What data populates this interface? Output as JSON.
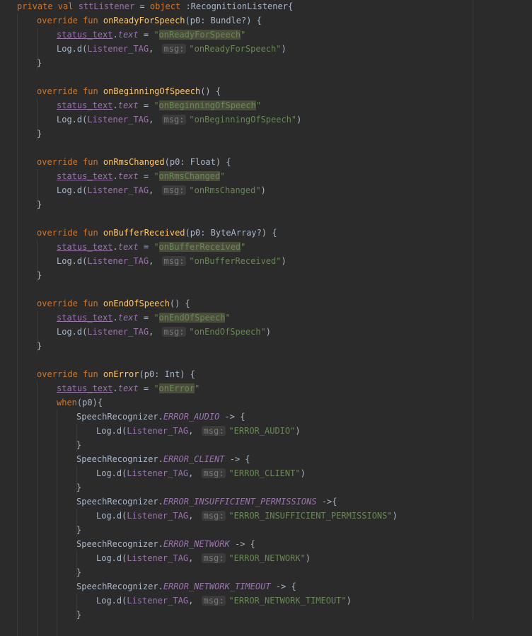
{
  "lines": [
    {
      "indent": 0,
      "toks": [
        [
          "kw",
          "private val "
        ],
        [
          "p",
          "sttListener"
        ],
        [
          "t",
          " = "
        ],
        [
          "kw",
          "object "
        ],
        [
          "t",
          ":RecognitionListener{"
        ]
      ]
    },
    {
      "indent": 1,
      "toks": [
        [
          "kw",
          "override fun "
        ],
        [
          "fn",
          "onReadyForSpeech"
        ],
        [
          "t",
          "(p0: Bundle?) {"
        ]
      ]
    },
    {
      "indent": 2,
      "toks": [
        [
          "pu",
          "status_text"
        ],
        [
          "t",
          "."
        ],
        [
          "pi",
          "text"
        ],
        [
          "t",
          " = "
        ],
        [
          "s",
          "\""
        ],
        [
          "sh",
          "onReadyForSpeech"
        ],
        [
          "s",
          "\""
        ]
      ]
    },
    {
      "indent": 2,
      "toks": [
        [
          "t",
          "Log.d("
        ],
        [
          "p",
          "Listener_TAG"
        ],
        [
          "t",
          ", "
        ],
        [
          "h",
          "msg:"
        ],
        [
          "s",
          "\"onReadyForSpeech\""
        ],
        [
          "t",
          ")"
        ]
      ]
    },
    {
      "indent": 1,
      "toks": [
        [
          "t",
          "}"
        ]
      ]
    },
    {
      "indent": 0,
      "toks": []
    },
    {
      "indent": 1,
      "toks": [
        [
          "kw",
          "override fun "
        ],
        [
          "fn",
          "onBeginningOfSpeech"
        ],
        [
          "t",
          "() {"
        ]
      ]
    },
    {
      "indent": 2,
      "toks": [
        [
          "pu",
          "status_text"
        ],
        [
          "t",
          "."
        ],
        [
          "pi",
          "text"
        ],
        [
          "t",
          " = "
        ],
        [
          "s",
          "\""
        ],
        [
          "sh",
          "onBeginningOfSpeech"
        ],
        [
          "s",
          "\""
        ]
      ]
    },
    {
      "indent": 2,
      "toks": [
        [
          "t",
          "Log.d("
        ],
        [
          "p",
          "Listener_TAG"
        ],
        [
          "t",
          ", "
        ],
        [
          "h",
          "msg:"
        ],
        [
          "s",
          "\"onBeginningOfSpeech\""
        ],
        [
          "t",
          ")"
        ]
      ]
    },
    {
      "indent": 1,
      "toks": [
        [
          "t",
          "}"
        ]
      ]
    },
    {
      "indent": 0,
      "toks": []
    },
    {
      "indent": 1,
      "toks": [
        [
          "kw",
          "override fun "
        ],
        [
          "fn",
          "onRmsChanged"
        ],
        [
          "t",
          "(p0: Float) {"
        ]
      ]
    },
    {
      "indent": 2,
      "toks": [
        [
          "pu",
          "status_text"
        ],
        [
          "t",
          "."
        ],
        [
          "pi",
          "text"
        ],
        [
          "t",
          " = "
        ],
        [
          "s",
          "\""
        ],
        [
          "sh",
          "onRmsChanged"
        ],
        [
          "s",
          "\""
        ]
      ]
    },
    {
      "indent": 2,
      "toks": [
        [
          "t",
          "Log.d("
        ],
        [
          "p",
          "Listener_TAG"
        ],
        [
          "t",
          ", "
        ],
        [
          "h",
          "msg:"
        ],
        [
          "s",
          "\"onRmsChanged\""
        ],
        [
          "t",
          ")"
        ]
      ]
    },
    {
      "indent": 1,
      "toks": [
        [
          "t",
          "}"
        ]
      ]
    },
    {
      "indent": 0,
      "toks": []
    },
    {
      "indent": 1,
      "toks": [
        [
          "kw",
          "override fun "
        ],
        [
          "fn",
          "onBufferReceived"
        ],
        [
          "t",
          "(p0: ByteArray?) {"
        ]
      ]
    },
    {
      "indent": 2,
      "toks": [
        [
          "pu",
          "status_text"
        ],
        [
          "t",
          "."
        ],
        [
          "pi",
          "text"
        ],
        [
          "t",
          " = "
        ],
        [
          "s",
          "\""
        ],
        [
          "sh",
          "onBufferReceived"
        ],
        [
          "s",
          "\""
        ]
      ]
    },
    {
      "indent": 2,
      "toks": [
        [
          "t",
          "Log.d("
        ],
        [
          "p",
          "Listener_TAG"
        ],
        [
          "t",
          ", "
        ],
        [
          "h",
          "msg:"
        ],
        [
          "s",
          "\"onBufferReceived\""
        ],
        [
          "t",
          ")"
        ]
      ]
    },
    {
      "indent": 1,
      "toks": [
        [
          "t",
          "}"
        ]
      ]
    },
    {
      "indent": 0,
      "toks": []
    },
    {
      "indent": 1,
      "toks": [
        [
          "kw",
          "override fun "
        ],
        [
          "fn",
          "onEndOfSpeech"
        ],
        [
          "t",
          "() {"
        ]
      ]
    },
    {
      "indent": 2,
      "toks": [
        [
          "pu",
          "status_text"
        ],
        [
          "t",
          "."
        ],
        [
          "pi",
          "text"
        ],
        [
          "t",
          " = "
        ],
        [
          "s",
          "\""
        ],
        [
          "sh",
          "onEndOfSpeech"
        ],
        [
          "s",
          "\""
        ]
      ]
    },
    {
      "indent": 2,
      "toks": [
        [
          "t",
          "Log.d("
        ],
        [
          "p",
          "Listener_TAG"
        ],
        [
          "t",
          ", "
        ],
        [
          "h",
          "msg:"
        ],
        [
          "s",
          "\"onEndOfSpeech\""
        ],
        [
          "t",
          ")"
        ]
      ]
    },
    {
      "indent": 1,
      "toks": [
        [
          "t",
          "}"
        ]
      ]
    },
    {
      "indent": 0,
      "toks": []
    },
    {
      "indent": 1,
      "toks": [
        [
          "kw",
          "override fun "
        ],
        [
          "fn",
          "onError"
        ],
        [
          "t",
          "(p0: Int) {"
        ]
      ]
    },
    {
      "indent": 2,
      "toks": [
        [
          "pu",
          "status_text"
        ],
        [
          "t",
          "."
        ],
        [
          "pi",
          "text"
        ],
        [
          "t",
          " = "
        ],
        [
          "s",
          "\""
        ],
        [
          "sh",
          "onError"
        ],
        [
          "s",
          "\""
        ]
      ]
    },
    {
      "indent": 2,
      "toks": [
        [
          "kw",
          "when"
        ],
        [
          "t",
          "(p0){"
        ]
      ]
    },
    {
      "indent": 3,
      "toks": [
        [
          "t",
          "SpeechRecognizer."
        ],
        [
          "pi",
          "ERROR_AUDIO"
        ],
        [
          "t",
          " -> {"
        ]
      ]
    },
    {
      "indent": 4,
      "toks": [
        [
          "t",
          "Log.d("
        ],
        [
          "p",
          "Listener_TAG"
        ],
        [
          "t",
          ", "
        ],
        [
          "h",
          "msg:"
        ],
        [
          "s",
          "\"ERROR_AUDIO\""
        ],
        [
          "t",
          ")"
        ]
      ]
    },
    {
      "indent": 3,
      "toks": [
        [
          "t",
          "}"
        ]
      ]
    },
    {
      "indent": 3,
      "toks": [
        [
          "t",
          "SpeechRecognizer."
        ],
        [
          "pi",
          "ERROR_CLIENT"
        ],
        [
          "t",
          " -> {"
        ]
      ]
    },
    {
      "indent": 4,
      "toks": [
        [
          "t",
          "Log.d("
        ],
        [
          "p",
          "Listener_TAG"
        ],
        [
          "t",
          ", "
        ],
        [
          "h",
          "msg:"
        ],
        [
          "s",
          "\"ERROR_CLIENT\""
        ],
        [
          "t",
          ")"
        ]
      ]
    },
    {
      "indent": 3,
      "toks": [
        [
          "t",
          "}"
        ]
      ]
    },
    {
      "indent": 3,
      "toks": [
        [
          "t",
          "SpeechRecognizer."
        ],
        [
          "pi",
          "ERROR_INSUFFICIENT_PERMISSIONS"
        ],
        [
          "t",
          " ->{"
        ]
      ]
    },
    {
      "indent": 4,
      "toks": [
        [
          "t",
          "Log.d("
        ],
        [
          "p",
          "Listener_TAG"
        ],
        [
          "t",
          ", "
        ],
        [
          "h",
          "msg:"
        ],
        [
          "s",
          "\"ERROR_INSUFFICIENT_PERMISSIONS\""
        ],
        [
          "t",
          ")"
        ]
      ]
    },
    {
      "indent": 3,
      "toks": [
        [
          "t",
          "}"
        ]
      ]
    },
    {
      "indent": 3,
      "toks": [
        [
          "t",
          "SpeechRecognizer."
        ],
        [
          "pi",
          "ERROR_NETWORK"
        ],
        [
          "t",
          " -> {"
        ]
      ]
    },
    {
      "indent": 4,
      "toks": [
        [
          "t",
          "Log.d("
        ],
        [
          "p",
          "Listener_TAG"
        ],
        [
          "t",
          ", "
        ],
        [
          "h",
          "msg:"
        ],
        [
          "s",
          "\"ERROR_NETWORK\""
        ],
        [
          "t",
          ")"
        ]
      ]
    },
    {
      "indent": 3,
      "toks": [
        [
          "t",
          "}"
        ]
      ]
    },
    {
      "indent": 3,
      "toks": [
        [
          "t",
          "SpeechRecognizer."
        ],
        [
          "pi",
          "ERROR_NETWORK_TIMEOUT"
        ],
        [
          "t",
          " -> {"
        ]
      ]
    },
    {
      "indent": 4,
      "toks": [
        [
          "t",
          "Log.d("
        ],
        [
          "p",
          "Listener_TAG"
        ],
        [
          "t",
          ", "
        ],
        [
          "h",
          "msg:"
        ],
        [
          "s",
          "\"ERROR_NETWORK_TIMEOUT\""
        ],
        [
          "t",
          ")"
        ]
      ]
    },
    {
      "indent": 3,
      "toks": [
        [
          "t",
          "}"
        ]
      ]
    }
  ],
  "colors": {
    "background": "#2b2b2b",
    "default_text": "#a9b7c6",
    "keyword": "#cc7832",
    "function_name": "#ffc66d",
    "property": "#9876aa",
    "string": "#6a8759",
    "string_highlight_bg": "#4b4d3c",
    "parameter_hint": "#787878"
  }
}
